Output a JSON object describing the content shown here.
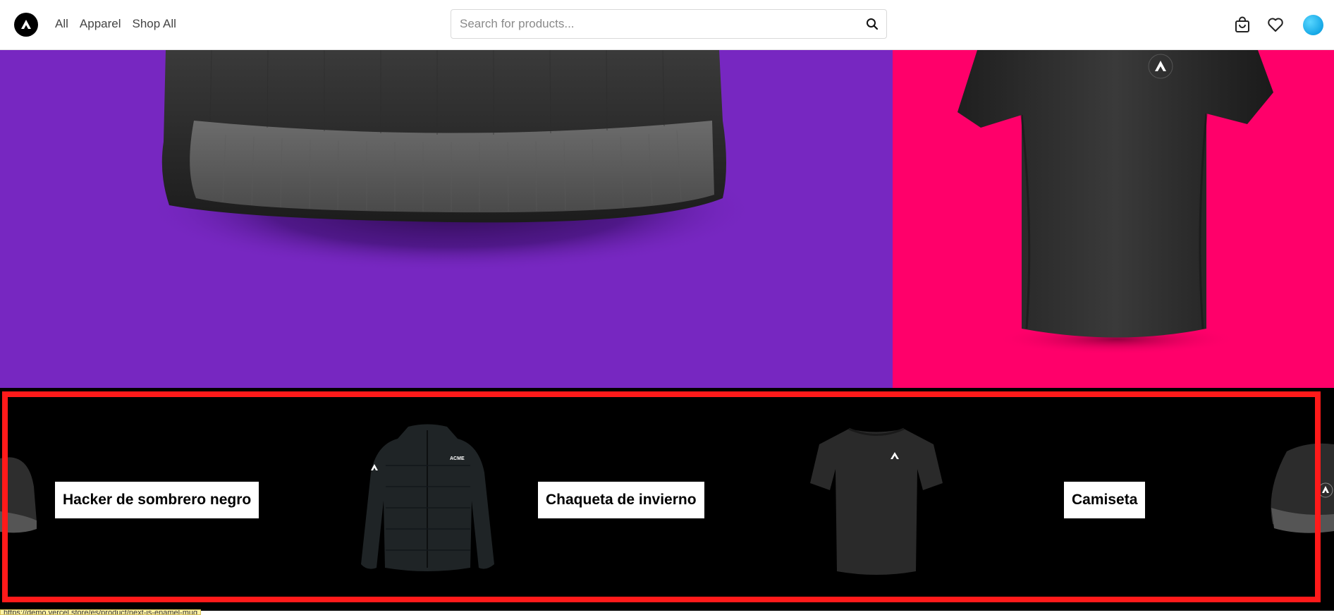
{
  "nav": {
    "links": [
      "All",
      "Apparel",
      "Shop All"
    ]
  },
  "search": {
    "placeholder": "Search for products..."
  },
  "marquee": {
    "items": [
      "Hacker de sombrero negro",
      "Chaqueta de invierno",
      "Camiseta"
    ]
  },
  "status_bar": {
    "url": "https://demo.vercel.store/es/product/next-js-enamel-mug"
  },
  "colors": {
    "hero_left_bg": "#7727c1",
    "hero_right_bg": "#ff006a",
    "marquee_bg": "#000000",
    "highlight_frame": "#ff1a1a"
  }
}
